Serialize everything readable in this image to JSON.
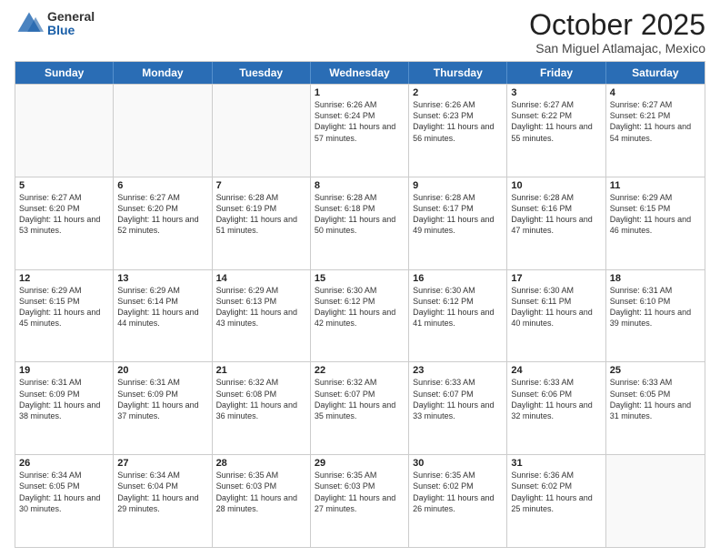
{
  "header": {
    "logo_general": "General",
    "logo_blue": "Blue",
    "month_title": "October 2025",
    "location": "San Miguel Atlamajac, Mexico"
  },
  "calendar": {
    "days_of_week": [
      "Sunday",
      "Monday",
      "Tuesday",
      "Wednesday",
      "Thursday",
      "Friday",
      "Saturday"
    ],
    "weeks": [
      [
        {
          "day": "",
          "empty": true
        },
        {
          "day": "",
          "empty": true
        },
        {
          "day": "",
          "empty": true
        },
        {
          "day": "1",
          "sunrise": "6:26 AM",
          "sunset": "6:24 PM",
          "daylight": "11 hours and 57 minutes."
        },
        {
          "day": "2",
          "sunrise": "6:26 AM",
          "sunset": "6:23 PM",
          "daylight": "11 hours and 56 minutes."
        },
        {
          "day": "3",
          "sunrise": "6:27 AM",
          "sunset": "6:22 PM",
          "daylight": "11 hours and 55 minutes."
        },
        {
          "day": "4",
          "sunrise": "6:27 AM",
          "sunset": "6:21 PM",
          "daylight": "11 hours and 54 minutes."
        }
      ],
      [
        {
          "day": "5",
          "sunrise": "6:27 AM",
          "sunset": "6:20 PM",
          "daylight": "11 hours and 53 minutes."
        },
        {
          "day": "6",
          "sunrise": "6:27 AM",
          "sunset": "6:20 PM",
          "daylight": "11 hours and 52 minutes."
        },
        {
          "day": "7",
          "sunrise": "6:28 AM",
          "sunset": "6:19 PM",
          "daylight": "11 hours and 51 minutes."
        },
        {
          "day": "8",
          "sunrise": "6:28 AM",
          "sunset": "6:18 PM",
          "daylight": "11 hours and 50 minutes."
        },
        {
          "day": "9",
          "sunrise": "6:28 AM",
          "sunset": "6:17 PM",
          "daylight": "11 hours and 49 minutes."
        },
        {
          "day": "10",
          "sunrise": "6:28 AM",
          "sunset": "6:16 PM",
          "daylight": "11 hours and 47 minutes."
        },
        {
          "day": "11",
          "sunrise": "6:29 AM",
          "sunset": "6:15 PM",
          "daylight": "11 hours and 46 minutes."
        }
      ],
      [
        {
          "day": "12",
          "sunrise": "6:29 AM",
          "sunset": "6:15 PM",
          "daylight": "11 hours and 45 minutes."
        },
        {
          "day": "13",
          "sunrise": "6:29 AM",
          "sunset": "6:14 PM",
          "daylight": "11 hours and 44 minutes."
        },
        {
          "day": "14",
          "sunrise": "6:29 AM",
          "sunset": "6:13 PM",
          "daylight": "11 hours and 43 minutes."
        },
        {
          "day": "15",
          "sunrise": "6:30 AM",
          "sunset": "6:12 PM",
          "daylight": "11 hours and 42 minutes."
        },
        {
          "day": "16",
          "sunrise": "6:30 AM",
          "sunset": "6:12 PM",
          "daylight": "11 hours and 41 minutes."
        },
        {
          "day": "17",
          "sunrise": "6:30 AM",
          "sunset": "6:11 PM",
          "daylight": "11 hours and 40 minutes."
        },
        {
          "day": "18",
          "sunrise": "6:31 AM",
          "sunset": "6:10 PM",
          "daylight": "11 hours and 39 minutes."
        }
      ],
      [
        {
          "day": "19",
          "sunrise": "6:31 AM",
          "sunset": "6:09 PM",
          "daylight": "11 hours and 38 minutes."
        },
        {
          "day": "20",
          "sunrise": "6:31 AM",
          "sunset": "6:09 PM",
          "daylight": "11 hours and 37 minutes."
        },
        {
          "day": "21",
          "sunrise": "6:32 AM",
          "sunset": "6:08 PM",
          "daylight": "11 hours and 36 minutes."
        },
        {
          "day": "22",
          "sunrise": "6:32 AM",
          "sunset": "6:07 PM",
          "daylight": "11 hours and 35 minutes."
        },
        {
          "day": "23",
          "sunrise": "6:33 AM",
          "sunset": "6:07 PM",
          "daylight": "11 hours and 33 minutes."
        },
        {
          "day": "24",
          "sunrise": "6:33 AM",
          "sunset": "6:06 PM",
          "daylight": "11 hours and 32 minutes."
        },
        {
          "day": "25",
          "sunrise": "6:33 AM",
          "sunset": "6:05 PM",
          "daylight": "11 hours and 31 minutes."
        }
      ],
      [
        {
          "day": "26",
          "sunrise": "6:34 AM",
          "sunset": "6:05 PM",
          "daylight": "11 hours and 30 minutes."
        },
        {
          "day": "27",
          "sunrise": "6:34 AM",
          "sunset": "6:04 PM",
          "daylight": "11 hours and 29 minutes."
        },
        {
          "day": "28",
          "sunrise": "6:35 AM",
          "sunset": "6:03 PM",
          "daylight": "11 hours and 28 minutes."
        },
        {
          "day": "29",
          "sunrise": "6:35 AM",
          "sunset": "6:03 PM",
          "daylight": "11 hours and 27 minutes."
        },
        {
          "day": "30",
          "sunrise": "6:35 AM",
          "sunset": "6:02 PM",
          "daylight": "11 hours and 26 minutes."
        },
        {
          "day": "31",
          "sunrise": "6:36 AM",
          "sunset": "6:02 PM",
          "daylight": "11 hours and 25 minutes."
        },
        {
          "day": "",
          "empty": true
        }
      ]
    ]
  },
  "labels": {
    "sunrise": "Sunrise:",
    "sunset": "Sunset:",
    "daylight": "Daylight:"
  }
}
